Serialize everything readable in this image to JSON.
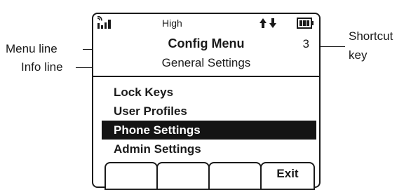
{
  "status_bar": {
    "signal_text": "High",
    "icons": [
      "signal-strength-icon",
      "up-down-arrows-icon",
      "battery-icon"
    ]
  },
  "menu_line": {
    "title": "Config Menu",
    "shortcut_number": "3"
  },
  "info_line": "General Settings",
  "menu_items": [
    {
      "label": "Lock Keys",
      "selected": false
    },
    {
      "label": "User Profiles",
      "selected": false
    },
    {
      "label": "Phone Settings",
      "selected": true
    },
    {
      "label": "Admin Settings",
      "selected": false
    }
  ],
  "softkeys": [
    "",
    "",
    "",
    "Exit"
  ],
  "callouts": {
    "menu_line": "Menu line",
    "info_line": "Info line",
    "shortcut_key_1": "Shortcut",
    "shortcut_key_2": "key"
  },
  "colors": {
    "ink": "#1a1a1a",
    "selected_bg": "#141414",
    "selected_text": "#ffffff"
  }
}
